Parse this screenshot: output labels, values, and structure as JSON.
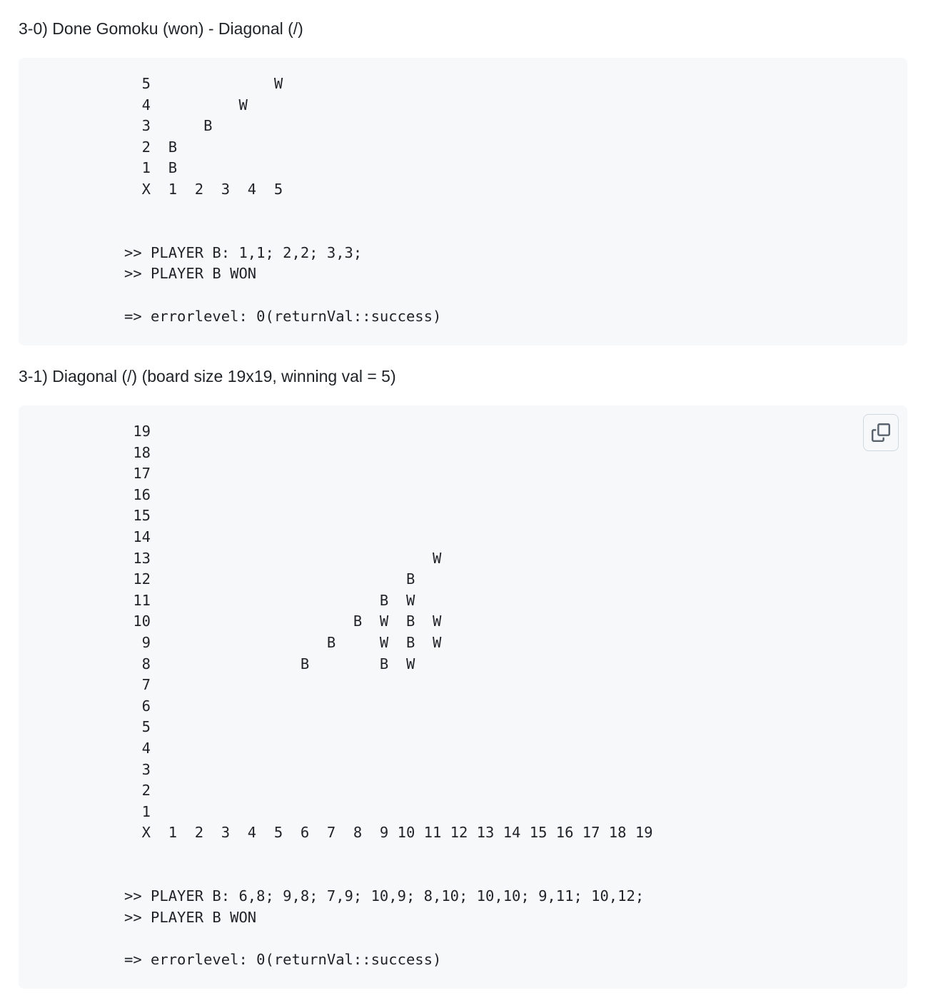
{
  "sections": [
    {
      "title": "3-0) Done Gomoku (won) - Diagonal (/)",
      "code": "  5              W\n  4          W\n  3      B\n  2  B\n  1  B\nX  1  2  3  4  5",
      "board": {
        "rows": [
          "  5              W",
          "  4          W",
          "  3      B",
          "  2  B",
          "  1  B",
          "  X  1  2  3  4  5"
        ]
      },
      "log": [
        ">> PLAYER B: 1,1; 2,2; 3,3;",
        ">> PLAYER B WON",
        "",
        "=> errorlevel: 0(returnVal::success)"
      ]
    },
    {
      "title": "3-1) Diagonal (/) (board size 19x19, winning val = 5)",
      "board": {
        "rows": [
          " 19",
          " 18",
          " 17",
          " 16",
          " 15",
          " 14",
          " 13                                W",
          " 12                             B",
          " 11                          B  W",
          " 10                       B  W  B  W",
          "  9                    B     W  B  W",
          "  8                 B        B  W",
          "  7",
          "  6",
          "  5",
          "  4",
          "  3",
          "  2",
          "  1",
          "  X  1  2  3  4  5  6  7  8  9 10 11 12 13 14 15 16 17 18 19"
        ]
      },
      "log": [
        ">> PLAYER B: 6,8; 9,8; 7,9; 10,9; 8,10; 10,10; 9,11; 10,12;",
        ">> PLAYER B WON",
        "",
        "=> errorlevel: 0(returnVal::success)"
      ],
      "copy_icon": "copy-icon"
    }
  ]
}
